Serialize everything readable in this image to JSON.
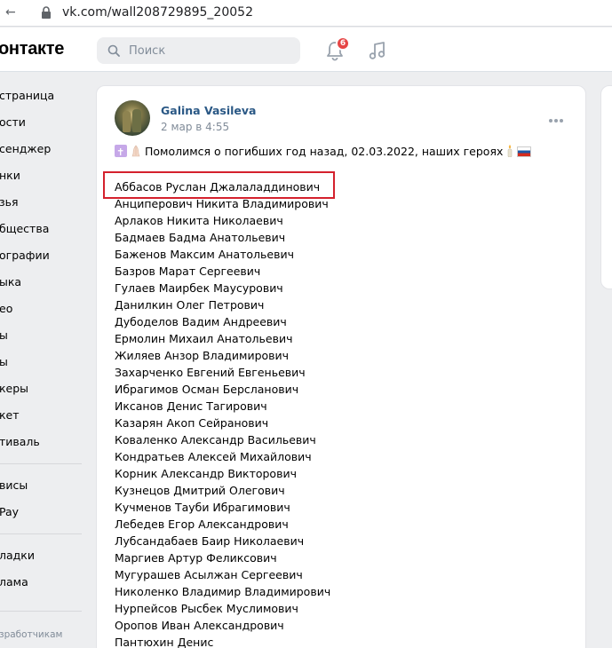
{
  "browser": {
    "url": "vk.com/wall208729895_20052"
  },
  "header": {
    "logo": "онтакте",
    "search_placeholder": "Поиск",
    "notification_count": "6"
  },
  "sidebar": {
    "items": [
      "страница",
      "ости",
      "сенджер",
      "нки",
      "зья",
      "бщества",
      "ографии",
      "ыка",
      "ео",
      "ы",
      "ы",
      "керы",
      "кет",
      "тиваль",
      "висы",
      "Pay",
      "ладки",
      "лама"
    ],
    "footer": "зработчикам"
  },
  "post": {
    "author": "Galina Vasileva",
    "date": "2 мар в 4:55",
    "headline": "Помолимся о погибших год назад, 02.03.2022, наших героях",
    "names": [
      "Аббасов Руслан Джалаладдинович",
      "Анциперович Никита Владимирович",
      "Арлаков Никита Николаевич",
      "Бадмаев Бадма Анатольевич",
      "Баженов Максим Анатольевич",
      "Базров Марат Сергеевич",
      "Гулаев Маирбек Маусурович",
      "Данилкин Олег Петрович",
      "Дубоделов Вадим Андреевич",
      "Ермолин Михаил Анатольевич",
      "Жиляев Анзор Владимирович",
      "Захарченко Евгений Евгеньевич",
      "Ибрагимов Осман Берсланович",
      "Иксанов Денис Тагирович",
      "Казарян Акоп Сейранович",
      "Коваленко Александр Васильевич",
      "Кондратьев Алексей Михайлович",
      "Корник Александр Викторович",
      "Кузнецов Дмитрий Олегович",
      "Кучменов Тауби Ибрагимович",
      "Лебедев Егор Александрович",
      "Лубсандабаев Баир Николаевич",
      "Маргиев Артур Феликсович",
      "Мугурашев Асылжан Сергеевич",
      "Николенко Владимир Владимирович",
      "Нурпейсов Рысбек Муслимович",
      "Оропов Иван Александрович",
      "Пантюхин Денис"
    ]
  },
  "colors": {
    "link": "#2a5885",
    "badge": "#e64646",
    "highlight_box": "#d4212d"
  }
}
